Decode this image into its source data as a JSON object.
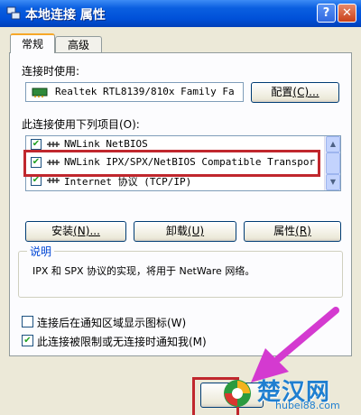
{
  "window": {
    "title": "本地连接 属性",
    "help_button": "?",
    "close_button": "✕"
  },
  "tabs": [
    {
      "label": "常规",
      "active": true
    },
    {
      "label": "高级",
      "active": false
    }
  ],
  "connect_using": {
    "label": "连接时使用:",
    "adapter": "Realtek RTL8139/810x Family Fa",
    "configure_button": "配置",
    "configure_accel": "(C)..."
  },
  "items_section": {
    "label": "此连接使用下列项目(O):",
    "items": [
      {
        "label": "NWLink NetBIOS",
        "checked": true
      },
      {
        "label": "NWLink IPX/SPX/NetBIOS Compatible Transpor",
        "checked": true
      },
      {
        "label": "Internet 协议 (TCP/IP)",
        "checked": true
      }
    ]
  },
  "buttons": {
    "install": "安装",
    "install_accel": "(N)...",
    "uninstall": "卸载",
    "uninstall_accel": "(U)",
    "properties": "属性",
    "properties_accel": "(R)"
  },
  "description": {
    "title": "说明",
    "text": "IPX 和 SPX 协议的实现，将用于 NetWare 网络。"
  },
  "options": [
    {
      "label": "连接后在通知区域显示图标(W)",
      "checked": false
    },
    {
      "label": "此连接被限制或无连接时通知我(M)",
      "checked": true
    }
  ],
  "watermark": {
    "text": "楚汉网",
    "url": "hubei88.com"
  },
  "colors": {
    "highlight": "#c0272d",
    "arrow": "#d43ad0",
    "watermark": "#1f7fd0"
  }
}
